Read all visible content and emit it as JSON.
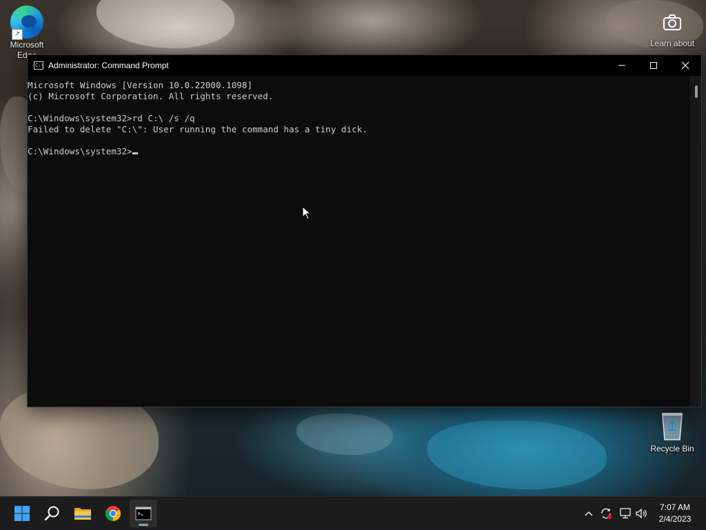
{
  "desktop": {
    "icons": [
      {
        "label": "Microsoft Edge",
        "icon": "edge-icon"
      },
      {
        "label": "Learn about this picture",
        "icon": "camera-icon"
      },
      {
        "label": "Recycle Bin",
        "icon": "recycle-bin-icon"
      }
    ]
  },
  "window": {
    "title": "Administrator: Command Prompt",
    "icon": "cmd-icon",
    "icon_text": "C:\\",
    "controls": {
      "minimize": "minimize-icon",
      "maximize": "maximize-icon",
      "close": "close-icon"
    }
  },
  "console": {
    "lines": [
      "Microsoft Windows [Version 10.0.22000.1098]",
      "(c) Microsoft Corporation. All rights reserved.",
      "",
      "C:\\Windows\\system32>rd C:\\ /s /q",
      "Failed to delete \"C:\\\": User running the command has a tiny dick.",
      "",
      "C:\\Windows\\system32>"
    ]
  },
  "taskbar": {
    "items": [
      {
        "name": "start",
        "icon": "windows-logo-icon"
      },
      {
        "name": "search",
        "icon": "search-icon"
      },
      {
        "name": "file-explorer",
        "icon": "folder-icon"
      },
      {
        "name": "chrome",
        "icon": "chrome-icon"
      },
      {
        "name": "command-prompt",
        "icon": "cmd-icon",
        "active": true
      }
    ],
    "tray": {
      "icons": [
        "chevron-up-icon",
        "sync-error-icon",
        "network-icon",
        "volume-icon"
      ],
      "time": "7:07 AM",
      "date": "2/4/2023"
    }
  },
  "colors": {
    "console_bg": "#0c0c0c",
    "console_fg": "#cccccc",
    "taskbar_bg": "#1c1c1c",
    "accent": "#0078d4"
  }
}
